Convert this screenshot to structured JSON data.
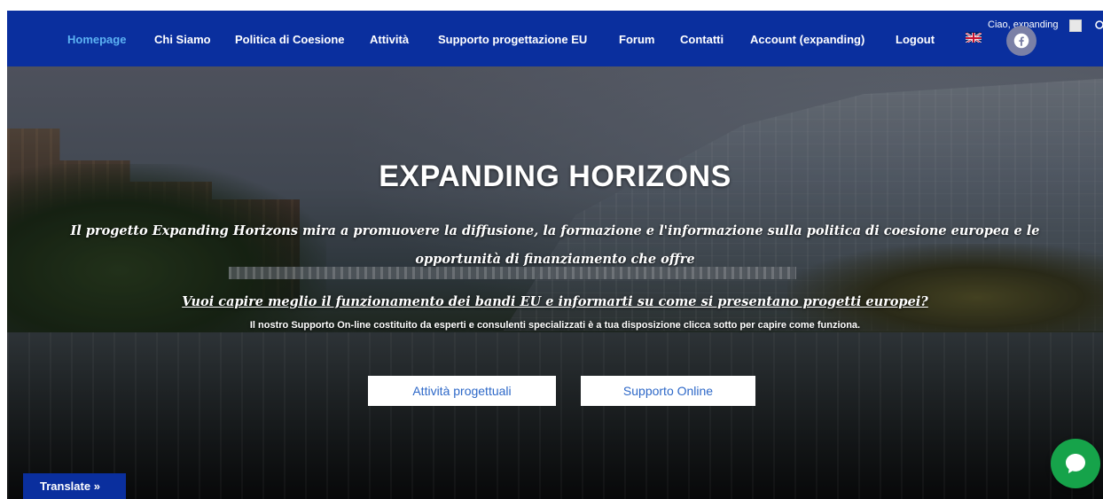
{
  "nav": {
    "items": [
      {
        "label": "Homepage",
        "active": true
      },
      {
        "label": "Chi Siamo",
        "active": false
      },
      {
        "label": "Politica di Coesione",
        "active": false
      },
      {
        "label": "Attività",
        "active": false
      },
      {
        "label": "Supporto progettazione EU",
        "active": false
      },
      {
        "label": "Forum",
        "active": false
      },
      {
        "label": "Contatti",
        "active": false
      },
      {
        "label": "Account (expanding)",
        "active": false
      },
      {
        "label": "Logout",
        "active": false
      }
    ],
    "greeting": "Ciao, expanding",
    "language_icon": "uk-flag-icon",
    "social_icon": "facebook-icon",
    "search_icon": "search-icon"
  },
  "hero": {
    "title": "EXPANDING HORIZONS",
    "lead": "Il progetto Expanding Horizons mira a promuovere la diffusione, la formazione e l'informazione sulla politica di coesione europea e le opportunità di finanziamento che offre",
    "question": "Vuoi capire meglio il funzionamento dei bandi EU e informarti su come si presentano progetti europei?",
    "support_text": "Il nostro Supporto On-line costituito da esperti e consulenti specializzati è a tua disposizione clicca sotto per capire come funziona.",
    "buttons": {
      "activity": "Attività progettuali",
      "support": "Supporto Online"
    }
  },
  "widgets": {
    "translate_label": "Translate »",
    "chat_icon": "chat-bubble-icon"
  },
  "colors": {
    "navbar": "#0a2f9e",
    "nav_active": "#5cb2f3",
    "button_text": "#2d68c8",
    "chat": "#16a34a"
  }
}
